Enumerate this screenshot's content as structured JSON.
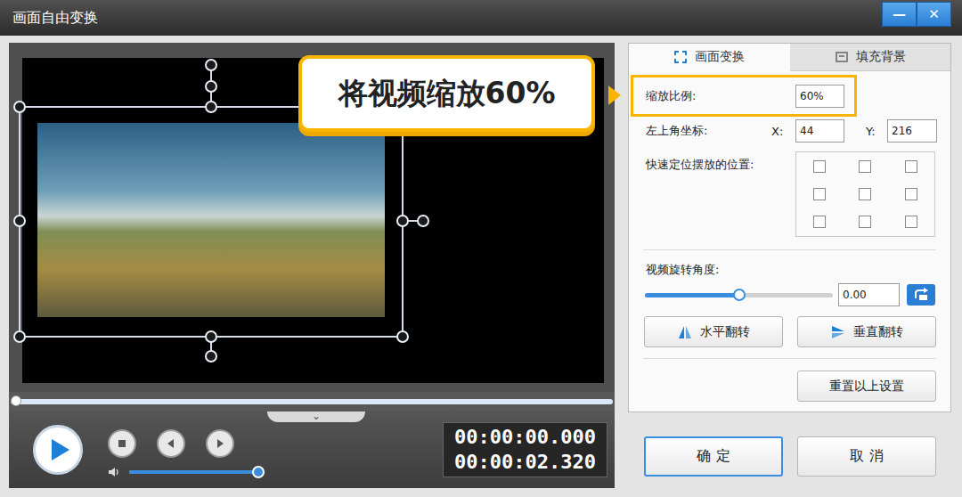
{
  "window": {
    "title": "画面自由变换",
    "controls": [
      "—",
      "✕"
    ]
  },
  "callout": {
    "text": "将视频缩放60%"
  },
  "preview": {
    "progress": 0,
    "volume": 1.0,
    "time_current": "00:00:00.000",
    "time_total": "00:00:02.320",
    "expand_glyph": "⌄"
  },
  "tabs": [
    {
      "label": "画面变换",
      "selected": true
    },
    {
      "label": "填充背景",
      "selected": false
    }
  ],
  "transform": {
    "scale": {
      "label": "缩放比例:",
      "value": "60%"
    },
    "position": {
      "label": "左上角坐标:",
      "x_label": "X:",
      "x": "44",
      "y_label": "Y:",
      "y": "216"
    },
    "quick_place": {
      "label": "快速定位摆放的位置:",
      "cells": [
        {
          "checked": false
        },
        {
          "checked": false
        },
        {
          "checked": false
        },
        {
          "checked": false
        },
        {
          "checked": false
        },
        {
          "checked": false
        },
        {
          "checked": false
        },
        {
          "checked": false
        },
        {
          "checked": false
        }
      ]
    },
    "rotation": {
      "label": "视频旋转角度:",
      "level": 0.5,
      "value": "0.00"
    },
    "flip_buttons": [
      "水平翻转",
      "垂直翻转"
    ],
    "reset": "重置以上设置"
  },
  "buttons": [
    {
      "label": "确 定",
      "primary": true
    },
    {
      "label": "取 消",
      "primary": false
    }
  ]
}
